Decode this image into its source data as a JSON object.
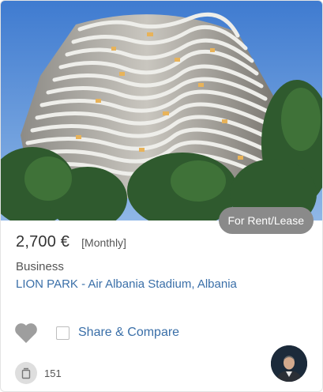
{
  "listing": {
    "image_alt": "Wavy-balconied residential tower",
    "badge": "For Rent/Lease",
    "price": "2,700 €",
    "period": "[Monthly]",
    "category": "Business",
    "location": "LION PARK - Air Albania Stadium, Albania",
    "share_compare_label": "Share & Compare",
    "photo_count": "151"
  },
  "icons": {
    "favorite": "heart-icon",
    "photos": "photo-stack-icon",
    "agent": "agent-avatar"
  },
  "colors": {
    "link": "#3a6fa8",
    "badge_bg": "#8a8a8a",
    "heart": "#9e9e9e",
    "sky": "#4d86cf"
  }
}
